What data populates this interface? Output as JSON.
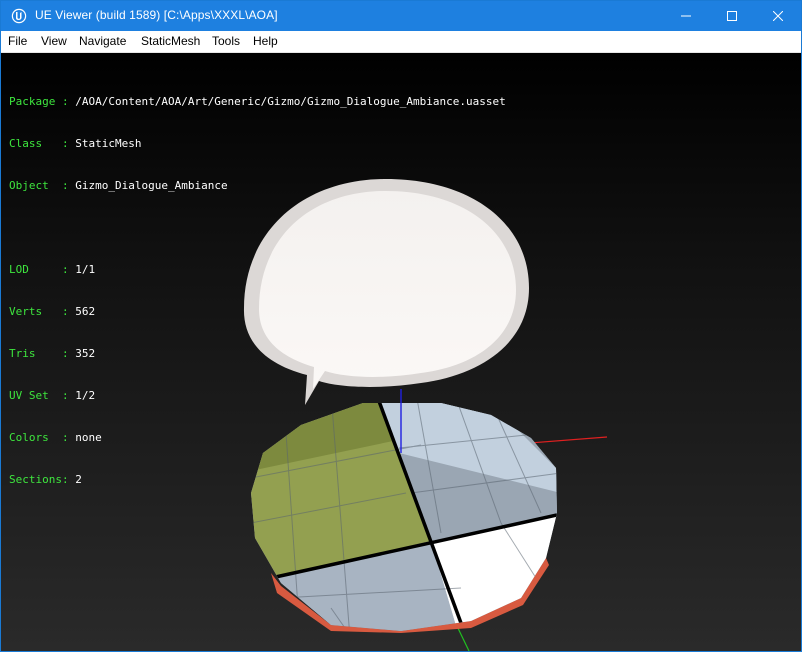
{
  "window": {
    "title": "UE Viewer (build 1589) [C:\\Apps\\XXXL\\AOA]"
  },
  "menu": {
    "items": [
      {
        "label": "File"
      },
      {
        "label": "View"
      },
      {
        "label": "Navigate"
      },
      {
        "label": "StaticMesh"
      },
      {
        "label": "Tools"
      },
      {
        "label": "Help"
      }
    ]
  },
  "info": {
    "package_label": "Package",
    "package": "/AOA/Content/AOA/Art/Generic/Gizmo/Gizmo_Dialogue_Ambiance.uasset",
    "class_label": "Class",
    "class": "StaticMesh",
    "object_label": "Object",
    "object": "Gizmo_Dialogue_Ambiance",
    "lod_label": "LOD",
    "lod": "1/1",
    "verts_label": "Verts",
    "verts": "562",
    "tris_label": "Tris",
    "tris": "352",
    "uvset_label": "UV Set",
    "uvset": "1/2",
    "colors_label": "Colors",
    "colors": "none",
    "sections_label": "Sections",
    "sections": "2"
  },
  "colors": {
    "titlebar": "#1e80e0",
    "info_key": "#3ee63e",
    "info_value": "#ffffff",
    "axis_x": "#e02020",
    "axis_y": "#20c020",
    "axis_z": "#2020e0"
  },
  "icons": {
    "app": "unreal-logo-icon",
    "minimize": "minimize-icon",
    "maximize": "maximize-icon",
    "close": "close-icon"
  }
}
